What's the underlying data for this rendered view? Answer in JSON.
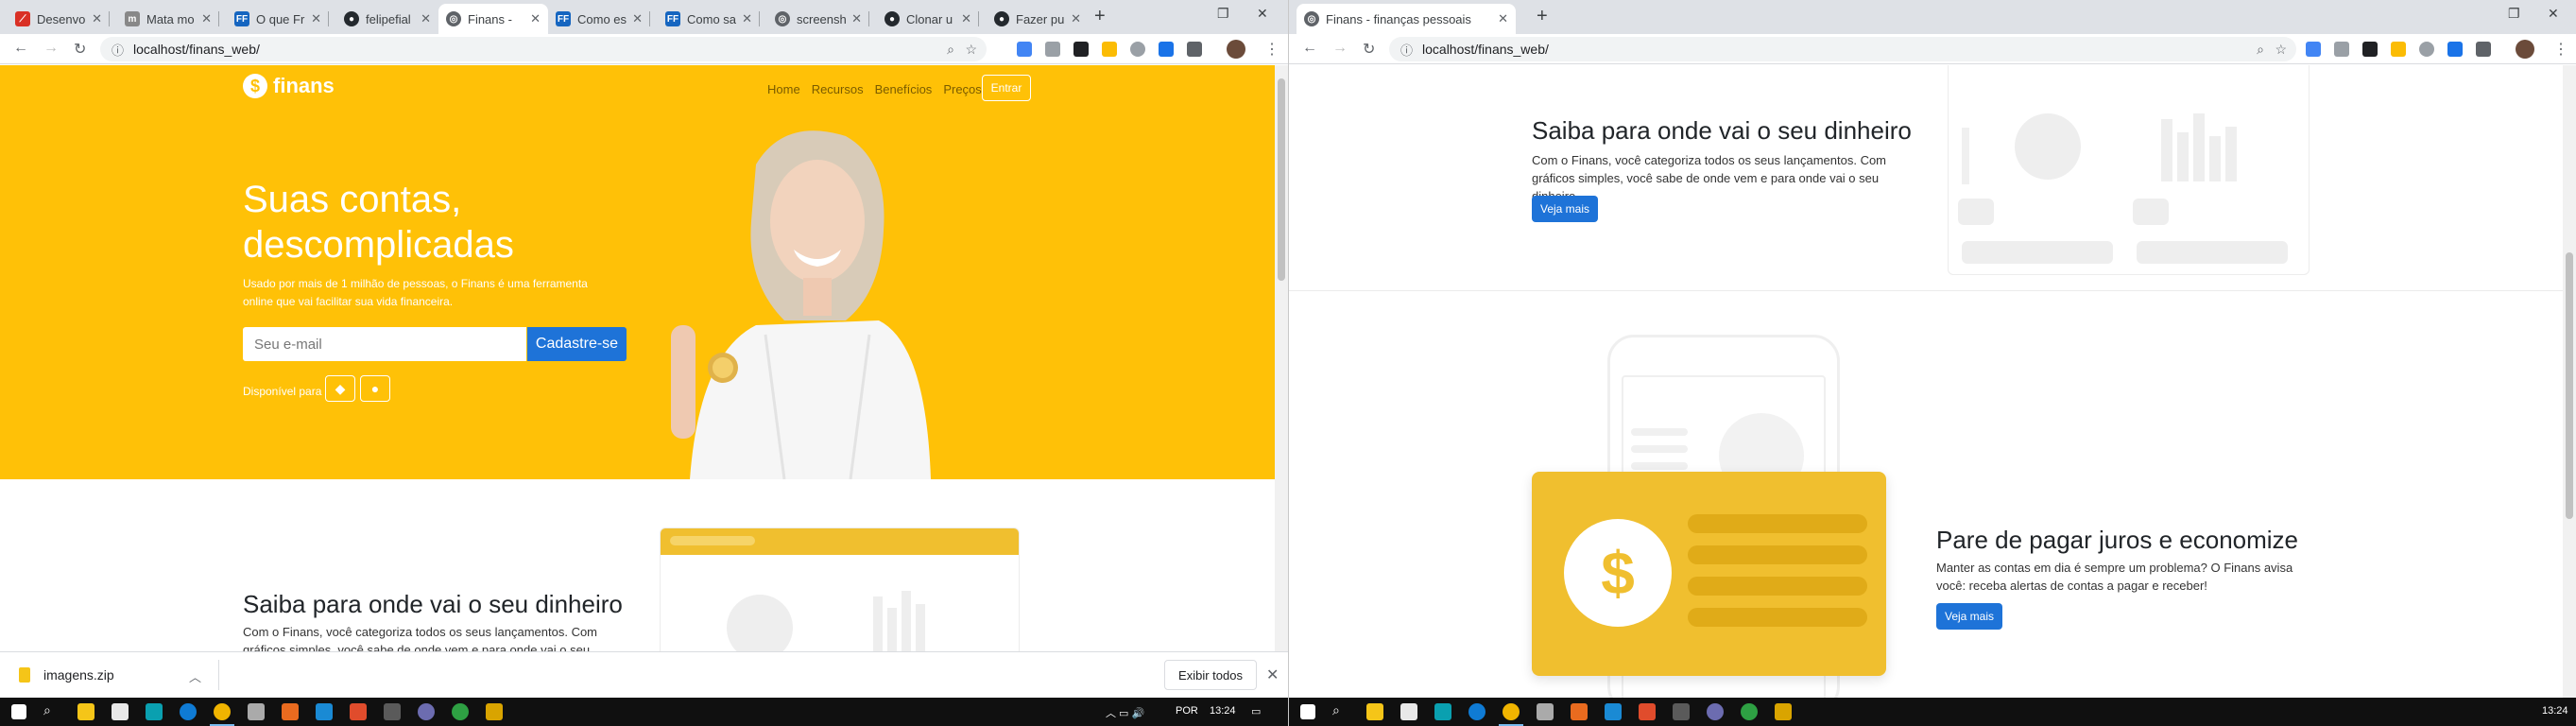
{
  "left": {
    "tabs": [
      {
        "title": "Desenvolv",
        "favicon": "a"
      },
      {
        "title": "Mata mo",
        "favicon": "m"
      },
      {
        "title": "O que Fr",
        "favicon": "FF"
      },
      {
        "title": "felipefial",
        "favicon": "gh"
      },
      {
        "title": "Finans -",
        "favicon": "g",
        "active": true
      },
      {
        "title": "Como es",
        "favicon": "FF"
      },
      {
        "title": "Como sa",
        "favicon": "FF"
      },
      {
        "title": "screensh",
        "favicon": "g"
      },
      {
        "title": "Clonar u",
        "favicon": "gh"
      },
      {
        "title": "Fazer pu",
        "favicon": "gh"
      }
    ],
    "url": "localhost/finans_web/",
    "downloads": {
      "file": "imagens.zip",
      "show_all": "Exibir todos"
    },
    "tray": {
      "lang": "POR",
      "time": "13:24"
    }
  },
  "right": {
    "tab": "Finans - finanças pessoais",
    "url": "localhost/finans_web/",
    "time": "13:24"
  },
  "site": {
    "brand": "finans",
    "nav": [
      "Home",
      "Recursos",
      "Benefícios",
      "Preços"
    ],
    "login": "Entrar",
    "hero_title": "Suas contas, descomplicadas",
    "hero_sub": "Usado por mais de 1 milhão de pessoas, o Finans é uma ferramenta online que vai facilitar sua vida financeira.",
    "email_placeholder": "Seu e-mail",
    "signup": "Cadastre-se",
    "available": "Disponível para",
    "section1_title": "Saiba para onde vai o seu dinheiro",
    "section1_text": "Com o Finans, você categoriza todos os seus lançamentos. Com gráficos simples, você sabe de onde vem e para onde vai o seu dinheiro.",
    "section2_title": "Pare de pagar juros e economize",
    "section2_text": "Manter as contas em dia é sempre um problema? O Finans avisa você: receba alertas de contas a pagar e receber!",
    "cta": "Veja mais"
  },
  "colors": {
    "brand_yellow": "#ffc107",
    "primary_blue": "#1e73d8"
  }
}
